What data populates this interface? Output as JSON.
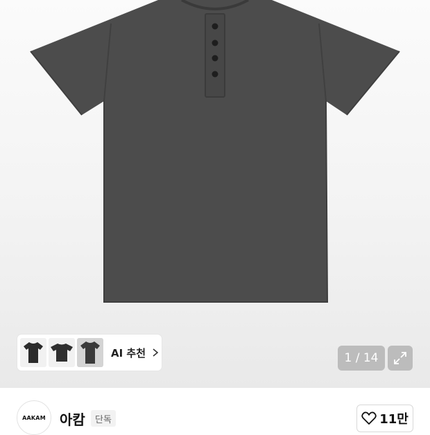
{
  "gallery": {
    "recommend_label": "AI 추천",
    "counter": "1 / 14",
    "main_image": "henley-tshirt-charcoal",
    "thumbnails": [
      "tshirt-black-front",
      "tshirt-black-alt",
      "tshirt-charcoal-henley"
    ]
  },
  "brand": {
    "logo_text": "AAKAM",
    "name": "아캄",
    "badge": "단독"
  },
  "like": {
    "count": "11만",
    "icon": "heart-outline-icon"
  },
  "colors": {
    "shirt": "#4a4a4a",
    "overlay": "#9a9a9a"
  }
}
